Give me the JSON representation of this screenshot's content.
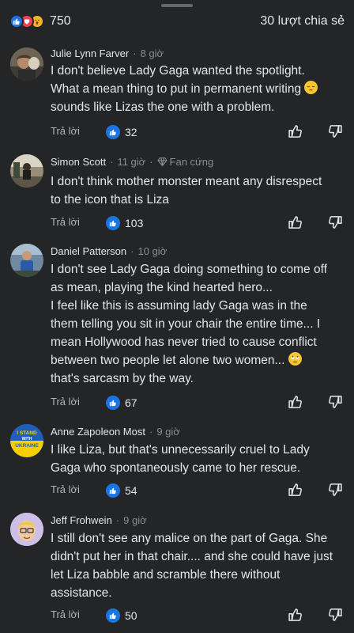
{
  "header": {
    "reaction_icons": [
      "like-icon",
      "love-icon",
      "wow-icon"
    ],
    "reaction_count": "750",
    "shares": "30 lượt chia sẻ"
  },
  "labels": {
    "reply": "Trả lời"
  },
  "colors": {
    "background": "#242526",
    "accent": "#1b74e4",
    "love": "#f33e58",
    "wow": "#f7b125",
    "muted": "#8a8d91"
  },
  "comments": [
    {
      "name": "Julie Lynn Farver",
      "time": "8 giờ",
      "badge": "",
      "text_lines": [
        "I don't believe Lady Gaga wanted the spotlight.",
        "What a mean thing to put in permanent writing",
        "sounds like Lizas the one with a problem."
      ],
      "emoji_after_line": 2,
      "emoji": "pensive-face",
      "likes": "32"
    },
    {
      "name": "Simon Scott",
      "time": "11 giờ",
      "badge": "Fan cứng",
      "text_lines": [
        "I don't think mother monster meant any disrespect",
        "to the icon that is Liza"
      ],
      "likes": "103"
    },
    {
      "name": "Daniel Patterson",
      "time": "10 giờ",
      "badge": "",
      "text_lines": [
        "I don't see Lady Gaga doing something to come off",
        "as mean, playing the kind hearted hero...",
        "I feel like this is assuming lady Gaga was in the",
        "them telling you sit in your chair the entire time... I",
        "mean Hollywood has never tried to cause conflict",
        "between two people let alone two women...",
        "that's sarcasm by the way."
      ],
      "emoji_after_line": 6,
      "emoji": "eye-roll-face",
      "likes": "67"
    },
    {
      "name": "Anne Zapoleon Most",
      "time": "9 giờ",
      "badge": "",
      "avatar_text": [
        "I STAND",
        "WITH",
        "UKRAINE"
      ],
      "text_lines": [
        "I like Liza, but that's unnecessarily cruel to Lady",
        "Gaga who spontaneously came to her rescue."
      ],
      "likes": "54"
    },
    {
      "name": "Jeff Frohwein",
      "time": "9 giờ",
      "badge": "",
      "text_lines": [
        "I still don't see any malice on the part of Gaga.  She",
        "didn't put her in that chair.... and she could have just",
        "let Liza babble and scramble there without",
        "assistance."
      ],
      "likes": "50"
    }
  ]
}
